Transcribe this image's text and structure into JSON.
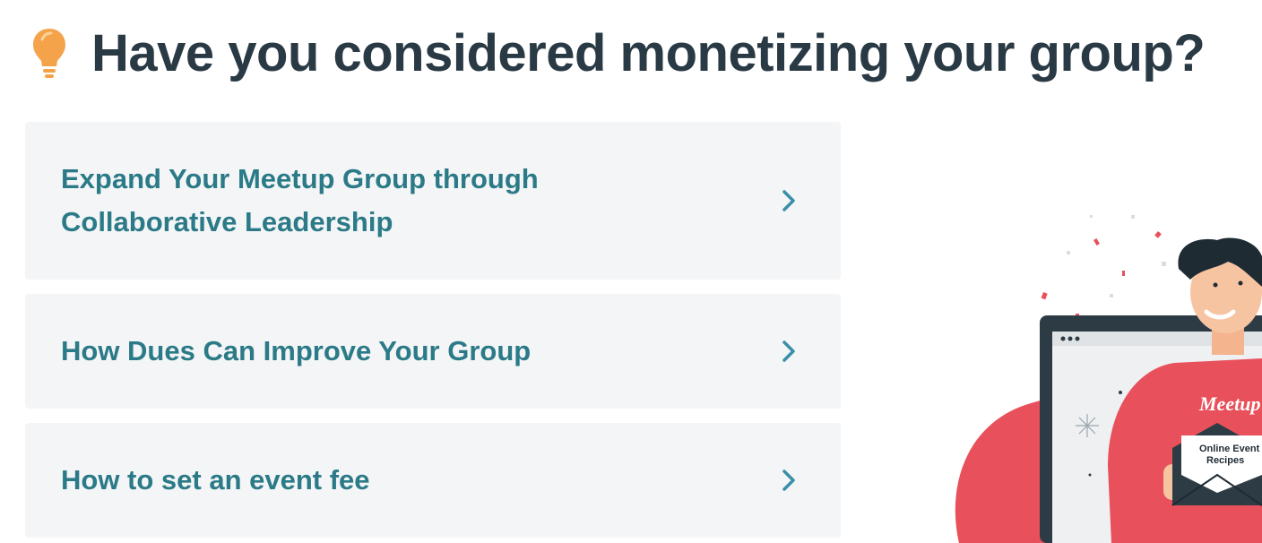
{
  "header": {
    "icon": "lightbulb-icon",
    "title": "Have you considered monetizing your group?"
  },
  "cards": [
    {
      "label": "Expand Your Meetup Group through Collaborative Leadership",
      "icon": "chevron-right-icon"
    },
    {
      "label": "How Dues Can Improve Your Group",
      "icon": "chevron-right-icon"
    },
    {
      "label": "How to set an event fee",
      "icon": "chevron-right-icon"
    }
  ],
  "illustration": {
    "shirt_text": "Meetup",
    "envelope_text": "Online Event Recipes"
  },
  "colors": {
    "title": "#2a3a45",
    "link": "#2b7a87",
    "card_bg": "#f4f5f7",
    "accent_red": "#e8505b",
    "bulb": "#f5a34a"
  }
}
